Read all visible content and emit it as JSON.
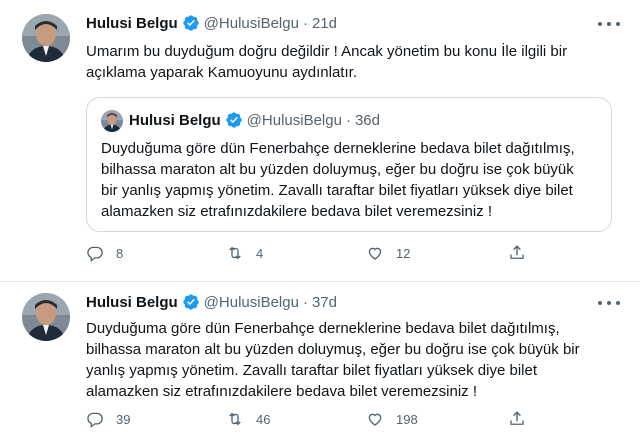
{
  "tweets": [
    {
      "author_name": "Hulusi Belgu",
      "handle": "@HulusiBelgu",
      "separator": "·",
      "time": "21d",
      "text": "Umarım bu duyduğum doğru değildir ! Ancak yönetim bu konu İle  ilgili bir\naçıklama yaparak Kamuoyunu aydınlatır.",
      "quote": {
        "author_name": "Hulusi Belgu",
        "handle": "@HulusiBelgu",
        "separator": "·",
        "time": "36d",
        "text": "Duyduğuma göre dün Fenerbahçe derneklerine bedava bilet dağıtılmış,\nbilhassa maraton alt bu yüzden doluymuş, eğer bu doğru ise çok büyük\nbir yanlış yapmış yönetim. Zavallı taraftar bilet fiyatları yüksek diye bilet\nalamazken siz etrafınızdakilere bedava bilet veremezsiniz !"
      },
      "replies": "8",
      "retweets": "4",
      "likes": "12"
    },
    {
      "author_name": "Hulusi Belgu",
      "handle": "@HulusiBelgu",
      "separator": "·",
      "time": "37d",
      "text": "Duyduğuma göre dün Fenerbahçe derneklerine bedava bilet dağıtılmış,\nbilhassa maraton alt bu yüzden doluymuş, eğer bu doğru ise çok büyük bir\nyanlış yapmış yönetim. Zavallı taraftar bilet fiyatları yüksek diye bilet\nalamazken siz etrafınızdakilere bedava bilet veremezsiniz !",
      "replies": "39",
      "retweets": "46",
      "likes": "198"
    }
  ],
  "icons": {
    "verified": "verified-badge-icon",
    "more": "more-options-icon",
    "reply": "reply-icon",
    "retweet": "retweet-icon",
    "like": "heart-icon",
    "share": "share-icon"
  },
  "colors": {
    "verified": "#1d9bf0",
    "secondary_text": "#536471",
    "primary_text": "#0f1419",
    "border": "#cfd9de"
  }
}
